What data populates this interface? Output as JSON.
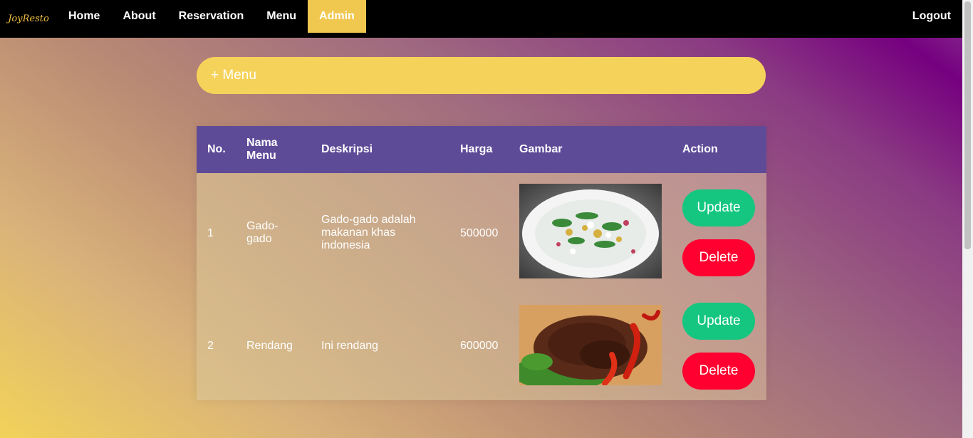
{
  "nav": {
    "brand": "JoyResto",
    "items": [
      "Home",
      "About",
      "Reservation",
      "Menu",
      "Admin"
    ],
    "active": "Admin",
    "logout": "Logout"
  },
  "add_button": "+ Menu",
  "table": {
    "headers": [
      "No.",
      "Nama Menu",
      "Deskripsi",
      "Harga",
      "Gambar",
      "Action"
    ],
    "rows": [
      {
        "no": "1",
        "nama": "Gado-gado",
        "deskripsi": "Gado-gado adalah makanan khas indonesia",
        "harga": "500000"
      },
      {
        "no": "2",
        "nama": "Rendang",
        "deskripsi": "Ini rendang",
        "harga": "600000"
      }
    ],
    "update_label": "Update",
    "delete_label": "Delete"
  },
  "colors": {
    "navbar": "#000000",
    "active_nav": "#f0c850",
    "add_button": "#f5d25a",
    "table_header": "#5e4b98",
    "update": "#14c680",
    "delete": "#ff0030"
  }
}
